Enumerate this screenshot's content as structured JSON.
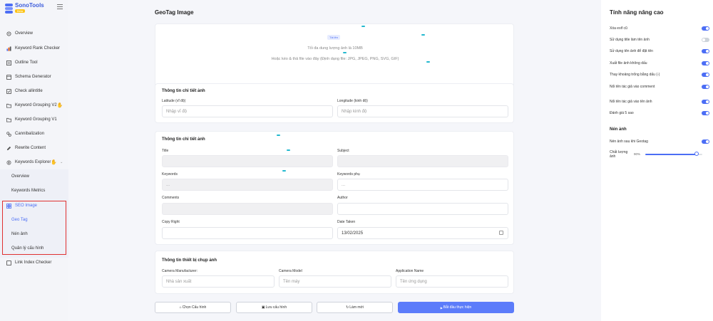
{
  "brand": {
    "name": "SonoTools",
    "badge": "Beta"
  },
  "sidebar": {
    "items": [
      {
        "label": "Overview",
        "icon": "dashboard-icon"
      },
      {
        "label": "Keyword Rank Checker",
        "icon": "rank-icon"
      },
      {
        "label": "Outline Tool",
        "icon": "outline-icon"
      },
      {
        "label": "Schema Generator",
        "icon": "schema-icon"
      },
      {
        "label": "Check allintitle",
        "icon": "checkbox-icon"
      },
      {
        "label": "Keyword Grouping V2",
        "icon": "folder-icon",
        "emoji": "✋"
      },
      {
        "label": "Keyword Grouping V1",
        "icon": "folder-icon"
      },
      {
        "label": "Cannibalization",
        "icon": "cannibal-icon"
      },
      {
        "label": "Rewrite Content",
        "icon": "pen-icon"
      },
      {
        "label": "Keywords Explorer",
        "icon": "explorer-icon",
        "emoji": "✋"
      }
    ],
    "sub_items": [
      "Overview",
      "Keywords Metrics"
    ],
    "seo_image": {
      "label": "SEO Image",
      "children": [
        "Geo Tag",
        "Nén ảnh",
        "Quản lý cấu hình"
      ]
    },
    "link_index": "Link Index Checker"
  },
  "main": {
    "title": "GeoTag Image",
    "upload": {
      "button": "Tải lên",
      "max_size": "Tối đa dung lượng ảnh là 10MB",
      "hint": "Hoặc kéo & thả file vào đây (Định dạng file: JPG, JPEG, PNG, SVG, GIF)"
    },
    "location": {
      "title": "Thông tin chi tiết ảnh",
      "latitude_label": "Latitude (vĩ độ)",
      "latitude_placeholder": "Nhập vĩ độ",
      "longitude_label": "Longitude (kinh độ)",
      "longitude_placeholder": "Nhập kinh độ"
    },
    "details": {
      "title": "Thông tin chi tiết ảnh",
      "title_label": "Title",
      "subject_label": "Subject",
      "keywords_label": "Keywords",
      "keywords_value": "...",
      "keywords_sub_label": "Keywords phụ",
      "keywords_sub_value": "...",
      "comments_label": "Comments",
      "author_label": "Author",
      "copyright_label": "Copy Right",
      "date_label": "Date Taken",
      "date_value": "13/02/2025"
    },
    "device": {
      "title": "Thông tin thiết bị chụp ảnh",
      "manufacturer_label": "Camera Manufacturer:",
      "manufacturer_placeholder": "Nhà sản xuất",
      "model_label": "Camera Model",
      "model_placeholder": "Tên máy",
      "app_label": "Application Name",
      "app_placeholder": "Tên ứng dụng"
    },
    "buttons": {
      "choose_config": "Chọn Cấu hình",
      "save_config": "Lưu cấu hình",
      "reset": "Làm mới",
      "start": "Bắt đầu thực hiện"
    }
  },
  "panel": {
    "title": "Tính năng nâng cao",
    "options": [
      {
        "label": "Xóa exif cũ",
        "on": true
      },
      {
        "label": "Sử dụng title làm tên ảnh",
        "on": false
      },
      {
        "label": "Sử dụng tên ảnh để đặt tên",
        "on": true
      },
      {
        "label": "Xuất file ảnh không dấu",
        "on": true
      },
      {
        "label": "Thay khoảng trống bằng dấu (-)",
        "on": true
      },
      {
        "label": "Nối tên tác giả vào comment",
        "on": true
      },
      {
        "label": "Nối tên tác giả vào tên ảnh",
        "on": true
      },
      {
        "label": "Đánh giá 5 sao",
        "on": true
      }
    ],
    "compress_title": "Nén ảnh",
    "compress_option": {
      "label": "Nén ảnh sau khi Geotag",
      "on": true
    },
    "quality_label": "Chất lượng ảnh",
    "quality_value": "90%",
    "quality": 0.9
  },
  "colors": {
    "accent": "#4c6ef5",
    "highlight": "#e03131",
    "brand_yellow": "#fcc419"
  }
}
